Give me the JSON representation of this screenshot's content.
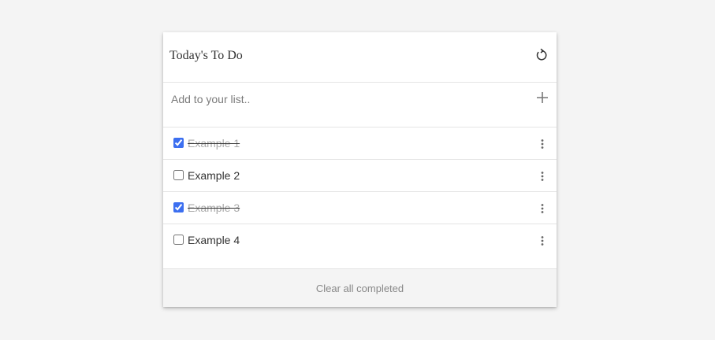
{
  "header": {
    "title": "Today's To Do",
    "reset_icon": "refresh-icon"
  },
  "add": {
    "placeholder": "Add to your list..",
    "value": "",
    "add_icon": "plus-icon"
  },
  "items": [
    {
      "label": "Example 1",
      "checked": true
    },
    {
      "label": "Example 2",
      "checked": false
    },
    {
      "label": "Example 3",
      "checked": true
    },
    {
      "label": "Example 4",
      "checked": false
    }
  ],
  "more_icon": "more-vertical-icon",
  "footer": {
    "clear_label": "Clear all completed"
  },
  "colors": {
    "background": "#f4f4f4",
    "card": "#ffffff",
    "accent": "#3c6ff0",
    "completed_text": "#aaaaaa",
    "footer_text": "#888888"
  }
}
